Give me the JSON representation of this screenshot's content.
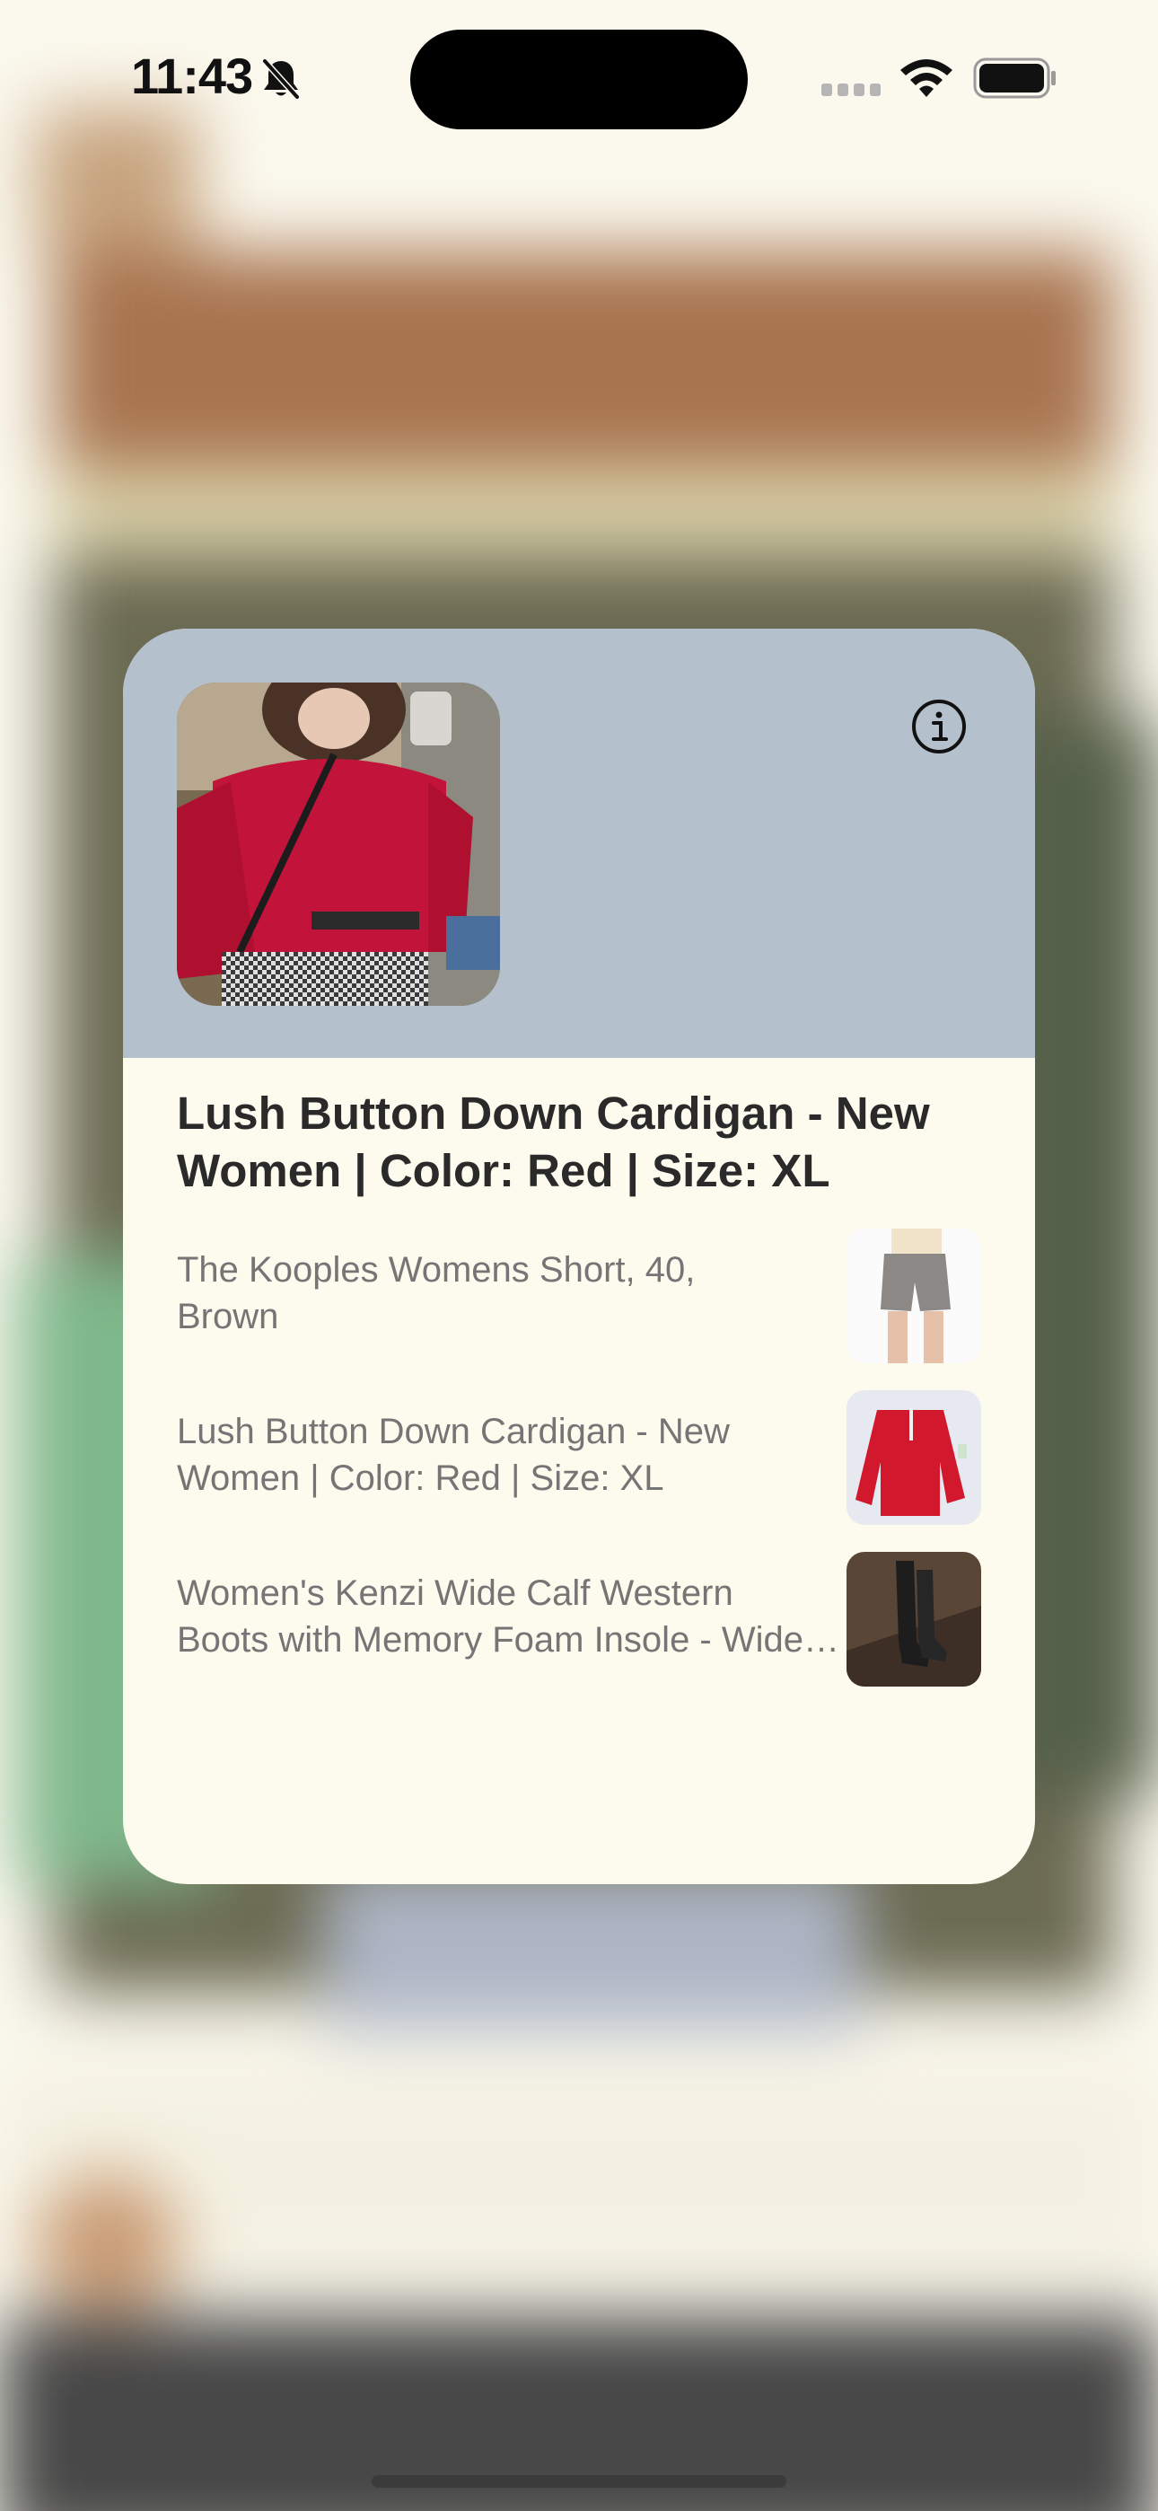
{
  "status_bar": {
    "time": "11:43"
  },
  "card": {
    "title": "Lush Button Down Cardigan - New Women | Color: Red | Size: XL",
    "header_color": "#b4c0cc",
    "items": [
      {
        "line1": "The Kooples Womens Short, 40,",
        "line2": "Brown"
      },
      {
        "line1": "Lush Button Down Cardigan - New",
        "line2": "Women | Color: Red | Size: XL"
      },
      {
        "line1": "Women's Kenzi Wide Calf Western",
        "line2": "Boots with Memory Foam Insole - Wide Calf"
      }
    ]
  },
  "icons": {
    "bell": "bell-slash-icon",
    "info": "info-circle-icon",
    "wifi": "wifi-icon",
    "battery": "battery-icon",
    "signal": "cellular-signal-icon"
  }
}
